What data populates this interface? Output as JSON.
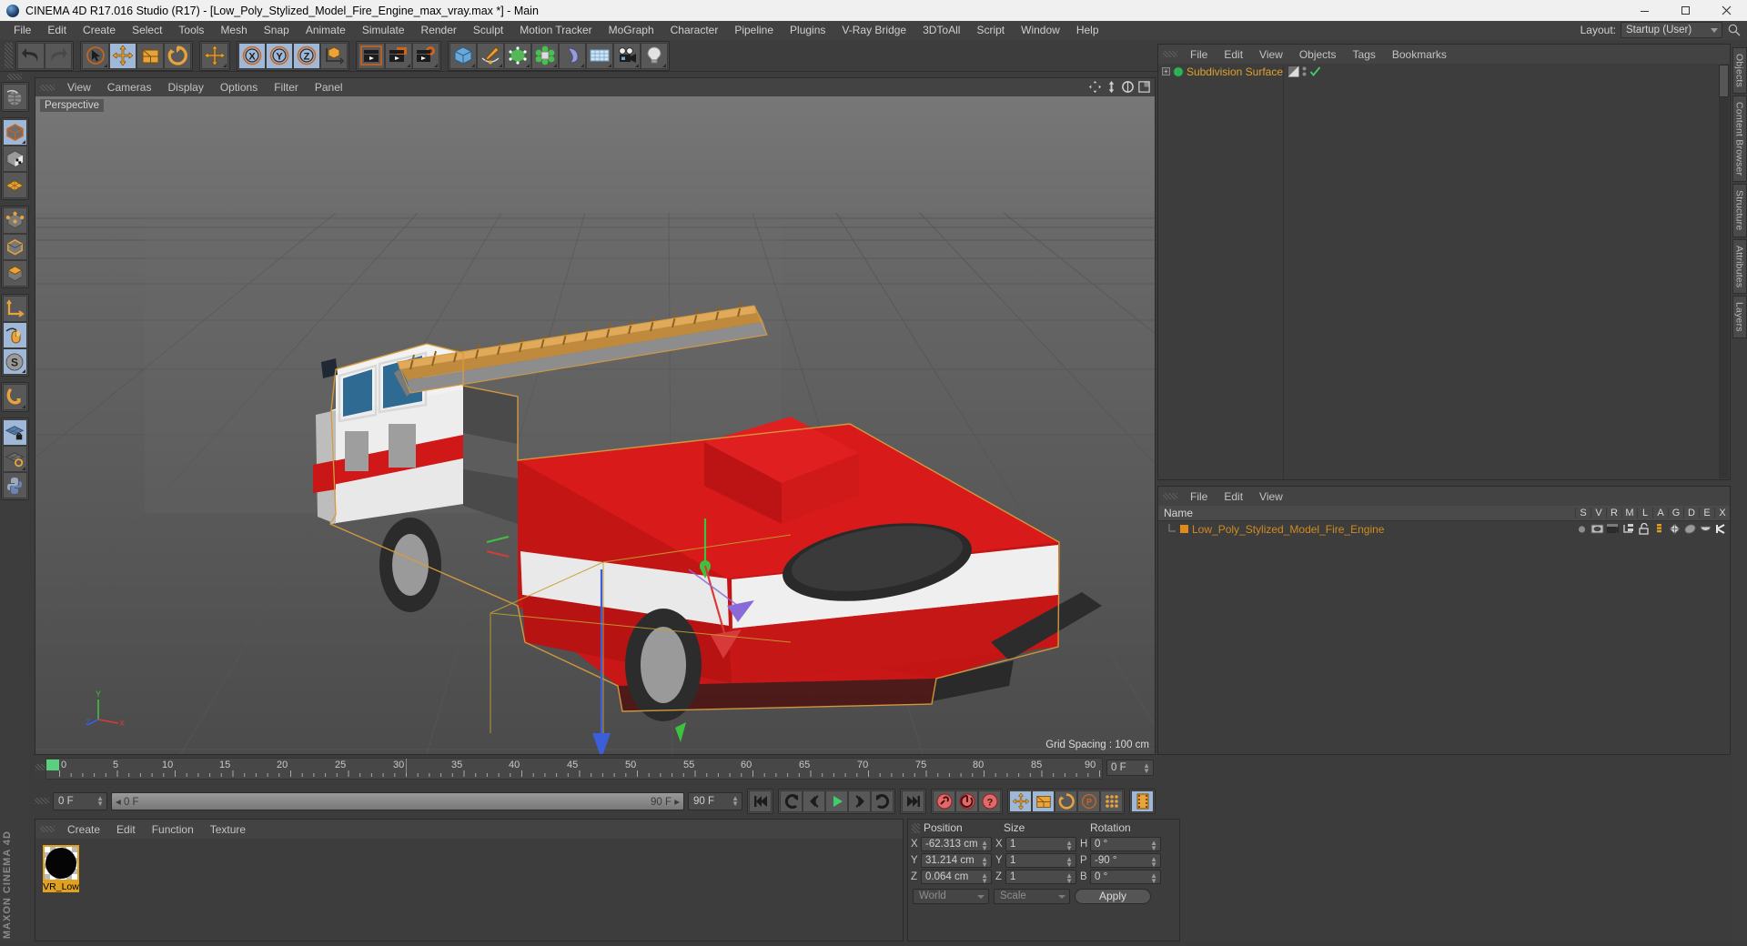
{
  "titlebar": {
    "title": "CINEMA 4D R17.016 Studio (R17) - [Low_Poly_Stylized_Model_Fire_Engine_max_vray.max *] - Main",
    "minimize": "minimize-icon",
    "maximize": "maximize-icon",
    "close": "close-icon"
  },
  "menubar": {
    "items": [
      "File",
      "Edit",
      "Create",
      "Select",
      "Tools",
      "Mesh",
      "Snap",
      "Animate",
      "Simulate",
      "Render",
      "Sculpt",
      "Motion Tracker",
      "MoGraph",
      "Character",
      "Pipeline",
      "Plugins",
      "V-Ray Bridge",
      "3DToAll",
      "Script",
      "Window",
      "Help"
    ],
    "layout_label": "Layout:",
    "layout_value": "Startup (User)"
  },
  "toolbar": {
    "groups": [
      {
        "name": "undo-redo",
        "buttons": [
          {
            "name": "undo-button",
            "icon": "undo-arrow-icon",
            "state": "normal"
          },
          {
            "name": "redo-button",
            "icon": "redo-arrow-icon",
            "state": "disabled"
          }
        ]
      },
      {
        "name": "transform-tools",
        "buttons": [
          {
            "name": "select-tool",
            "icon": "live-selection-icon",
            "state": "normal"
          },
          {
            "name": "move-tool",
            "icon": "move-arrows-icon",
            "state": "selected"
          },
          {
            "name": "scale-tool",
            "icon": "scale-box-icon",
            "state": "normal"
          },
          {
            "name": "rotate-tool",
            "icon": "rotate-arrows-icon",
            "state": "normal"
          }
        ]
      },
      {
        "name": "world-axis",
        "buttons": [
          {
            "name": "move-world-tool",
            "icon": "move-arrows-icon",
            "state": "normal"
          }
        ]
      },
      {
        "name": "axis-locks",
        "buttons": [
          {
            "name": "lock-x-axis",
            "icon": "x-axis-icon",
            "state": "selected",
            "label": "X"
          },
          {
            "name": "lock-y-axis",
            "icon": "y-axis-icon",
            "state": "selected",
            "label": "Y"
          },
          {
            "name": "lock-z-axis",
            "icon": "z-axis-icon",
            "state": "selected",
            "label": "Z"
          },
          {
            "name": "world-object-coordinates",
            "icon": "world-coordinate-icon",
            "state": "normal"
          }
        ]
      },
      {
        "name": "render-group",
        "buttons": [
          {
            "name": "render-view-button",
            "icon": "render-view-icon",
            "state": "normal"
          },
          {
            "name": "render-to-picture-viewer",
            "icon": "render-picture-viewer-icon",
            "state": "normal"
          },
          {
            "name": "edit-render-settings",
            "icon": "render-settings-icon",
            "state": "normal"
          }
        ]
      },
      {
        "name": "object-create-group",
        "buttons": [
          {
            "name": "add-cube-button",
            "icon": "cube-primitive-icon",
            "state": "normal"
          },
          {
            "name": "add-spline-button",
            "icon": "pen-spline-icon",
            "state": "normal"
          },
          {
            "name": "add-generator-button",
            "icon": "nurbs-generator-icon",
            "state": "normal"
          },
          {
            "name": "add-mograph-button",
            "icon": "mograph-icon",
            "state": "normal"
          },
          {
            "name": "add-deformer-button",
            "icon": "bend-deformer-icon",
            "state": "normal"
          },
          {
            "name": "add-scene-button",
            "icon": "floor-scene-icon",
            "state": "normal"
          },
          {
            "name": "add-camera-button",
            "icon": "camera-icon",
            "state": "normal"
          },
          {
            "name": "add-light-button",
            "icon": "light-bulb-icon",
            "state": "normal"
          }
        ]
      }
    ]
  },
  "left_palette": {
    "groups": [
      [
        "texture-axis-tool"
      ],
      [
        "model-mode-tool",
        "texture-mode-tool",
        "polygon-grid-tool"
      ],
      [
        "points-mode-tool",
        "edges-mode-tool",
        "polygons-mode-tool"
      ],
      [
        "object-axis-tool",
        "enable-axis-modification-tool",
        "snap-settings-tool"
      ],
      [
        "magnet-tool"
      ],
      [
        "workplane-lock-tool",
        "workplane-rotate-tool",
        "python-tool"
      ]
    ],
    "brand": "MAXON CINEMA 4D"
  },
  "viewport": {
    "menu": [
      "View",
      "Cameras",
      "Display",
      "Options",
      "Filter",
      "Panel"
    ],
    "view_label": "Perspective",
    "grid_spacing": "Grid Spacing : 100 cm",
    "icons": [
      "pan-view-icon",
      "zoom-view-icon",
      "rotate-view-icon",
      "maximize-view-icon"
    ],
    "axis": {
      "x": "X",
      "y": "Y",
      "z": "Z"
    }
  },
  "object_manager": {
    "menu": [
      "File",
      "Edit",
      "View",
      "Objects",
      "Tags",
      "Bookmarks"
    ],
    "items": [
      {
        "label": "Subdivision Surface",
        "icon": "subdivision-surface-icon",
        "expander": "+",
        "visible_dot_top": "#8a8a8a",
        "visible_dot_bottom": "#8a8a8a",
        "tag_icon": "shading-tag-icon",
        "check": "✔"
      }
    ]
  },
  "material_manager_right": {
    "menu": [
      "File",
      "Edit",
      "View"
    ],
    "columns": [
      "Name",
      "S",
      "V",
      "R",
      "M",
      "L",
      "A",
      "G",
      "D",
      "E",
      "X"
    ],
    "rows": [
      {
        "name": "Low_Poly_Stylized_Model_Fire_Engine",
        "swatch": "#e08a1e",
        "tags": [
          "dot-icon",
          "display-icon",
          "render-icon",
          "layer-icon",
          "unlock-icon",
          "level-icon",
          "deformer-icon",
          "cache-icon",
          "hide-icon",
          "x-icon"
        ]
      }
    ]
  },
  "right_tabs": [
    "Objects",
    "Content Browser",
    "Structure",
    "Attributes",
    "Layers"
  ],
  "timeline": {
    "labels": [
      "0",
      "5",
      "10",
      "15",
      "20",
      "25",
      "30",
      "35",
      "40",
      "45",
      "50",
      "55",
      "60",
      "65",
      "70",
      "75",
      "80",
      "85",
      "90"
    ],
    "current_frame_field": "0 F",
    "start_field": "0 F",
    "slider_start": "0 F",
    "slider_end": "90 F",
    "end_field": "90 F"
  },
  "transport": {
    "buttons": [
      {
        "name": "go-to-start-button",
        "icon": "skip-start-icon"
      },
      {
        "name": "previous-key-button",
        "icon": "step-back-key-icon"
      },
      {
        "name": "previous-frame-button",
        "icon": "step-back-frame-icon"
      },
      {
        "name": "play-button",
        "icon": "play-icon"
      },
      {
        "name": "next-frame-button",
        "icon": "step-forward-frame-icon"
      },
      {
        "name": "next-key-button",
        "icon": "step-forward-key-icon"
      },
      {
        "name": "go-to-end-button",
        "icon": "skip-end-icon"
      }
    ],
    "record_buttons": [
      {
        "name": "record-active-objects-button",
        "icon": "record-key-icon"
      },
      {
        "name": "autokeying-button",
        "icon": "autokey-icon"
      },
      {
        "name": "keyframe-selection-button",
        "icon": "question-key-icon"
      }
    ],
    "key_toggles": [
      {
        "name": "position-key-toggle",
        "icon": "move-arrows-icon",
        "state": "selected"
      },
      {
        "name": "scale-key-toggle",
        "icon": "scale-box-icon",
        "state": "selected"
      },
      {
        "name": "rotation-key-toggle",
        "icon": "rotate-arrows-icon",
        "state": "normal"
      },
      {
        "name": "parameter-key-toggle",
        "icon": "parameter-p-icon",
        "state": "normal"
      },
      {
        "name": "point-level-animation-toggle",
        "icon": "pla-dots-icon",
        "state": "normal"
      }
    ],
    "timeline_toggle": {
      "name": "animation-layer-button",
      "icon": "filmstrip-icon",
      "state": "selected"
    }
  },
  "material_panel": {
    "menu": [
      "Create",
      "Edit",
      "Function",
      "Texture"
    ],
    "materials": [
      {
        "name": "VR_Low",
        "swatch": "#050505"
      }
    ]
  },
  "coordinates": {
    "headers": [
      "Position",
      "Size",
      "Rotation"
    ],
    "rows": [
      {
        "axis1": "X",
        "value1": "-62.313 cm",
        "axis2": "X",
        "value2": "1",
        "axis3": "H",
        "value3": "0 °"
      },
      {
        "axis1": "Y",
        "value1": "31.214 cm",
        "axis2": "Y",
        "value2": "1",
        "axis3": "P",
        "value3": "-90 °"
      },
      {
        "axis1": "Z",
        "value1": "0.064 cm",
        "axis2": "Z",
        "value2": "1",
        "axis3": "B",
        "value3": "0 °"
      }
    ],
    "coord_system": "World",
    "size_mode": "Scale",
    "apply_label": "Apply"
  },
  "colors": {
    "accent_orange": "#e08a1e",
    "selected_blue": "#9fb8d8",
    "panel_bg": "#3d3d3d",
    "truck_red": "#d01515"
  }
}
